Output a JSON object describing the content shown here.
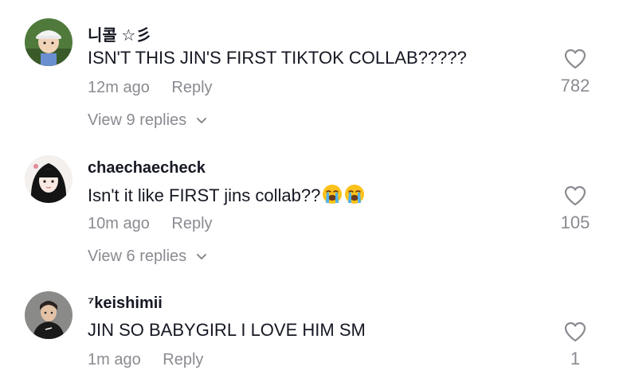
{
  "comments": [
    {
      "username": "니콜 ☆彡",
      "text": "ISN'T THIS JIN'S FIRST TIKTOK COLLAB?????",
      "time": "12m ago",
      "reply_label": "Reply",
      "likes": "782",
      "view_replies": "View 9 replies",
      "emojis": []
    },
    {
      "username": "chaechaecheck",
      "text": "Isn't it like FIRST jins collab??",
      "time": "10m ago",
      "reply_label": "Reply",
      "likes": "105",
      "view_replies": "View 6 replies",
      "emojis": [
        "loudly-crying-face",
        "loudly-crying-face"
      ]
    },
    {
      "username": "⁷keishimii",
      "text": "JIN SO BABYGIRL I LOVE HIM SM",
      "time": "1m ago",
      "reply_label": "Reply",
      "likes": "1",
      "emojis": []
    }
  ],
  "icons": {
    "like": "heart-outline-icon",
    "expand": "chevron-down-icon"
  },
  "colors": {
    "text_primary": "#161823",
    "text_secondary": "#8a8b91"
  }
}
